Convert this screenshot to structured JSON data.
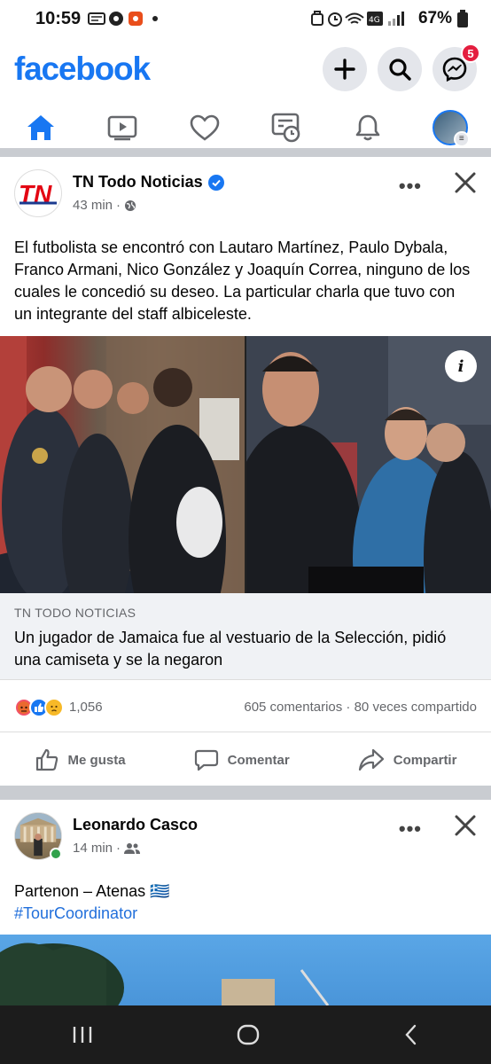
{
  "status": {
    "time": "10:59",
    "battery": "67%"
  },
  "header": {
    "logo": "facebook",
    "messenger_badge": "5"
  },
  "posts": [
    {
      "author": "TN Todo Noticias",
      "avatar_text": "TN",
      "time": "43 min",
      "text": "El futbolista se encontró con Lautaro Martínez, Paulo Dybala, Franco Armani, Nico González y Joaquín Correa, ninguno de los cuales le concedió su deseo. La particular charla que tuvo con un integrante del staff albiceleste.",
      "link_domain": "TN TODO NOTICIAS",
      "link_title": "Un jugador de Jamaica fue al vestuario de la Selección, pidió una camiseta y se la negaron",
      "reactions_count": "1,056",
      "comments_shares": "605 comentarios · 80 veces compartido"
    },
    {
      "author": "Leonardo Casco",
      "time": "14 min",
      "text": "Partenon – Atenas 🇬🇷",
      "hashtag": "#TourCoordinator"
    }
  ],
  "actions": {
    "like": "Me gusta",
    "comment": "Comentar",
    "share": "Compartir"
  },
  "colors": {
    "brand": "#1877f2",
    "badge": "#e41e3f"
  }
}
